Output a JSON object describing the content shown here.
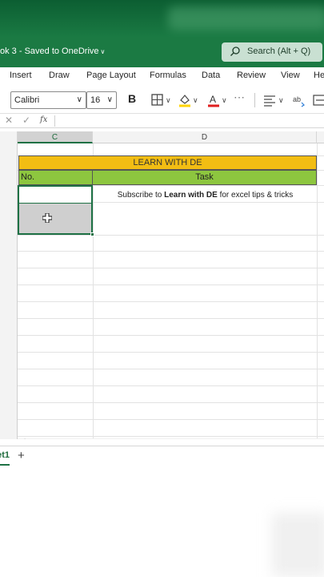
{
  "window": {
    "doc_title": "ok 3  -  Saved to OneDrive",
    "search_text": "Search (Alt + Q)"
  },
  "ribbon_tabs": [
    "Insert",
    "Draw",
    "Page Layout",
    "Formulas",
    "Data",
    "Review",
    "View",
    "He"
  ],
  "ribbon": {
    "font_name": "Calibri",
    "font_size": "16",
    "bold_label": "B"
  },
  "formula_bar": {
    "cancel": "✕",
    "enter": "✓",
    "fx": "fx"
  },
  "columns": [
    "C",
    "D"
  ],
  "sheet": {
    "banner": "LEARN WITH DE",
    "header_no": "No.",
    "header_task": "Task",
    "task_prefix": "Subscribe to ",
    "task_bold": "Learn with DE",
    "task_suffix": " for excel tips & tricks"
  },
  "sheet_tabs": {
    "active": "et1",
    "add": "+"
  },
  "colors": {
    "excel_green": "#1b7a43",
    "banner_yellow": "#f2bd13",
    "header_green": "#8dc63f",
    "selection_border": "#1e7145"
  }
}
